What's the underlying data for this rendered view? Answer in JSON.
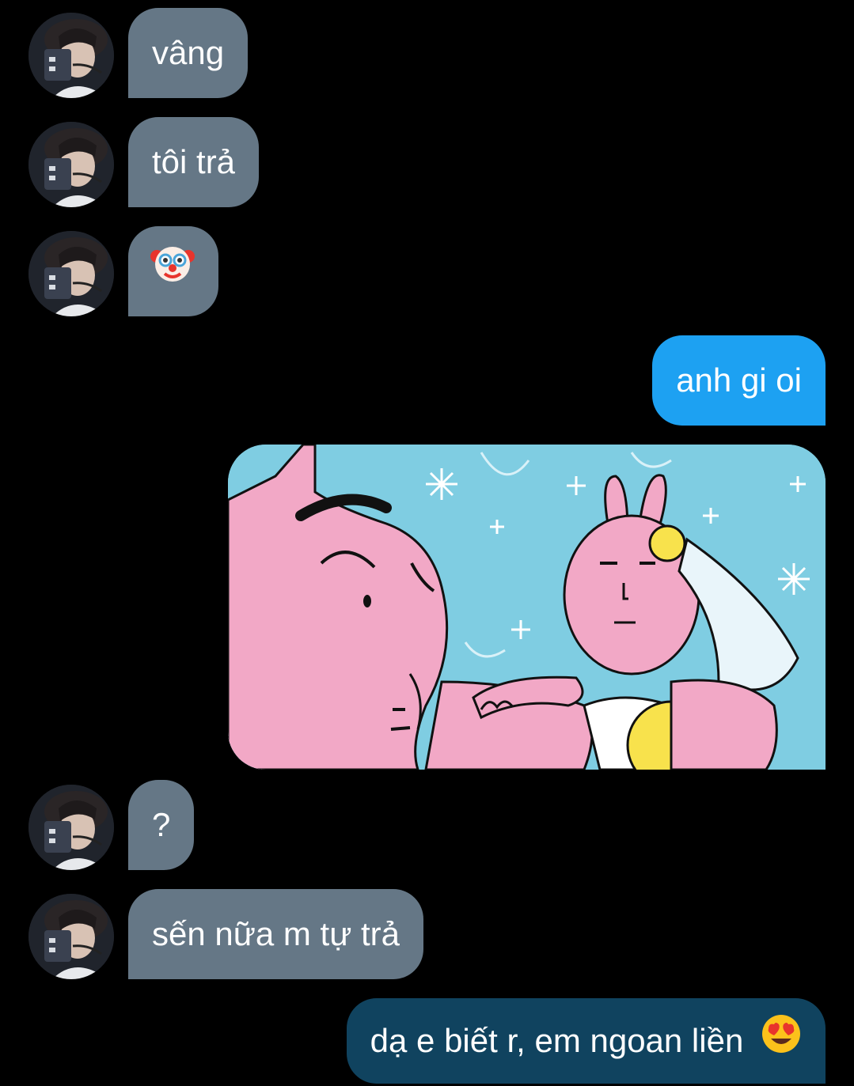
{
  "conversation": {
    "messages": [
      {
        "id": "m1",
        "direction": "incoming",
        "text": "vâng"
      },
      {
        "id": "m2",
        "direction": "incoming",
        "text": "tôi trả"
      },
      {
        "id": "m3",
        "direction": "incoming",
        "emoji": "clown-face"
      },
      {
        "id": "m4",
        "direction": "outgoing",
        "text": "anh gi oi"
      },
      {
        "id": "m5",
        "direction": "outgoing",
        "image": "pink-rabbit-cartoon-meme"
      },
      {
        "id": "m6",
        "direction": "incoming",
        "text": "?"
      },
      {
        "id": "m7",
        "direction": "incoming",
        "text": "sến nữa m tự trả"
      },
      {
        "id": "m8",
        "direction": "outgoing",
        "text": "dạ e biết r, em ngoan liền",
        "emoji": "smiling-face-heart-eyes"
      }
    ]
  },
  "colors": {
    "background": "#000000",
    "incoming_bubble": "#657786",
    "outgoing_bubble": "#1da1f2",
    "outgoing_bubble_dark": "#10435f"
  }
}
